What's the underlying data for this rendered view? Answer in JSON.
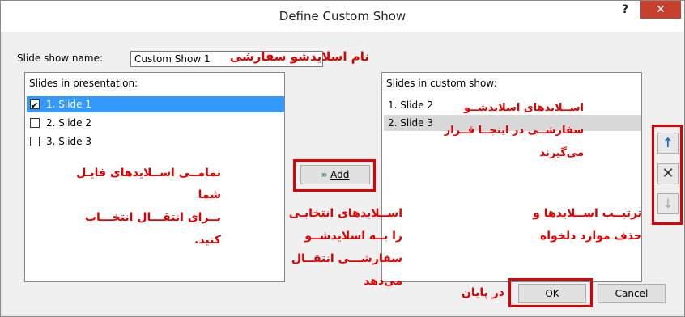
{
  "dialog": {
    "title": "Define Custom Show",
    "help": "?",
    "close": "✕"
  },
  "name_label": "Slide show name:",
  "name_value": "Custom Show 1",
  "left_list": {
    "title": "Slides in presentation:",
    "items": [
      {
        "label": "1. Slide 1",
        "checked": true,
        "selected": true
      },
      {
        "label": "2. Slide 2",
        "checked": false,
        "selected": false
      },
      {
        "label": "3. Slide 3",
        "checked": false,
        "selected": false
      }
    ]
  },
  "add_button": {
    "icon": "double-arrow-right-icon",
    "label": "Add"
  },
  "right_list": {
    "title": "Slides in custom show:",
    "items": [
      "1. Slide 2",
      "2. Slide 3"
    ]
  },
  "side_buttons": [
    {
      "icon": "arrow-up-icon",
      "symbol": "↑"
    },
    {
      "icon": "remove-icon",
      "symbol": "✕"
    },
    {
      "icon": "arrow-down-icon",
      "symbol": "↓"
    }
  ],
  "ok_label": "OK",
  "cancel_label": "Cancel",
  "annotations": {
    "name": "نام اسلایدشو سفارشی",
    "left_1": "تمامــی اســلایدهای فایـل",
    "left_2": "شما",
    "left_3": "بــرای انتقـــال انتخـــاب",
    "left_4": "کنید.",
    "mid_1": "اســلایدهای انتخابـی",
    "mid_2": "را بــه اسلایدشــو",
    "mid_3": "سفارشـــی انتقــال",
    "mid_4": "می‌دهد",
    "right_1": "اســلایدهای اسلایدشــو",
    "right_2": "سفارشــی در اینجــا قــرار",
    "right_3": "می‌گیرند",
    "order_1": "ترتیــب اســلایدها و",
    "order_2": "حذف موارد دلخواه",
    "final": "در پایان"
  },
  "colors": {
    "annotation": "#e00000",
    "selection": "#3399ff",
    "close": "#c7402e"
  }
}
